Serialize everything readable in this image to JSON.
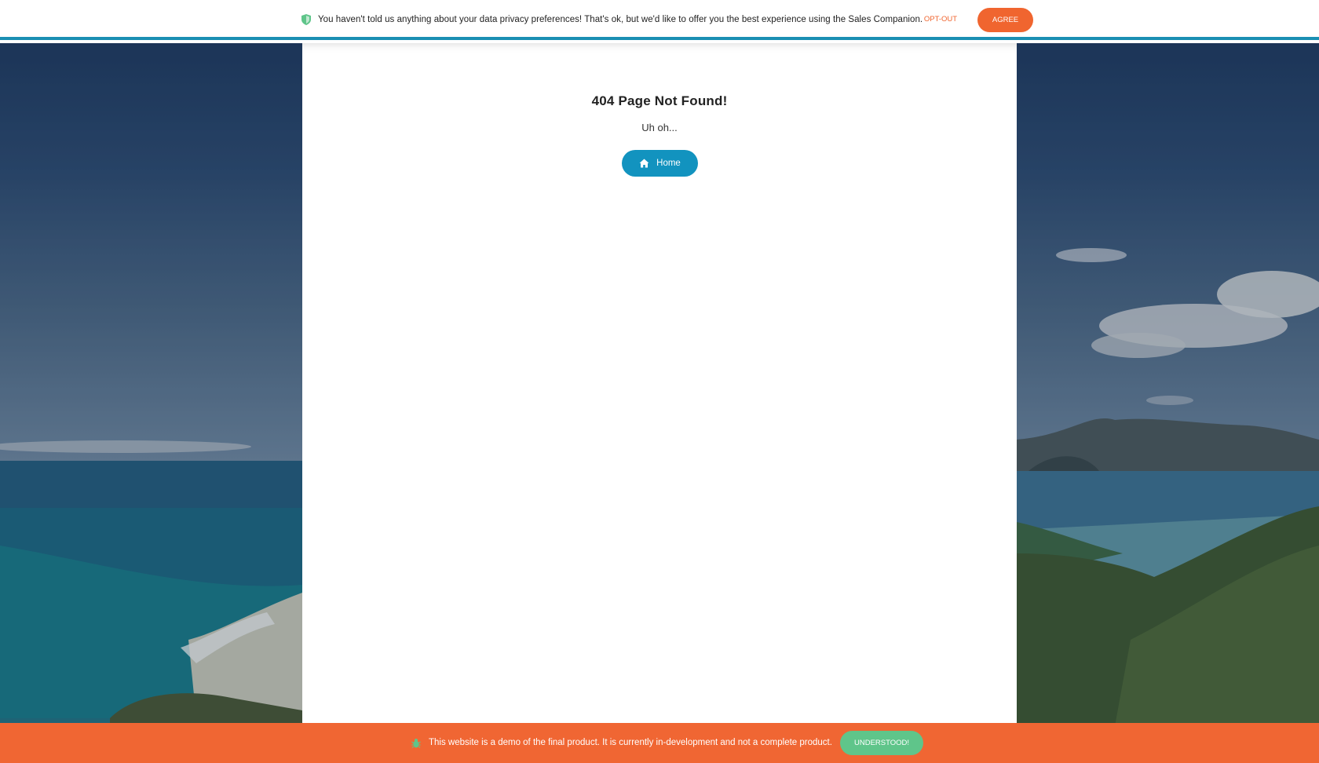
{
  "privacy_banner": {
    "icon": "shield-icon",
    "message": "You haven't told us anything about your data privacy preferences! That's ok, but we'd like to offer you the best experience using the Sales Companion.",
    "optout_label": "OPT-OUT",
    "agree_label": "AGREE",
    "colors": {
      "accent_line": "#1a8fb3",
      "agree_bg": "#f0652f",
      "optout_text": "#f0652f",
      "shield": "#5fc58a"
    }
  },
  "main": {
    "title": "404 Page Not Found!",
    "subtitle": "Uh oh...",
    "home_button": {
      "label": "Home",
      "icon": "home-icon",
      "color": "#1293bf"
    }
  },
  "demo_banner": {
    "icon": "bug-icon",
    "message": "This website is a demo of the final product. It is currently in-development and not a complete product.",
    "understood_label": "UNDERSTOOD!",
    "colors": {
      "background": "#f06633",
      "button_bg": "#5fc58a"
    }
  }
}
